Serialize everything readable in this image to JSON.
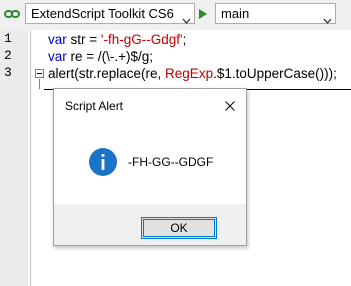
{
  "toolbar": {
    "target_app": "ExtendScript Toolkit CS6",
    "engine": "main",
    "link_icon": "link-icon",
    "run_icon": "run-arrow-icon",
    "dropdown_icon": "chevron-down-icon",
    "accent_color": "#2c8a2c"
  },
  "editor": {
    "line_numbers": [
      "1",
      "2",
      "3"
    ],
    "lines": [
      {
        "tokens": [
          [
            "kw",
            "var"
          ],
          [
            "plain",
            " str = "
          ],
          [
            "str",
            "'-fh-gG--Gdgf'"
          ],
          [
            "plain",
            ";"
          ]
        ]
      },
      {
        "tokens": [
          [
            "kw",
            "var"
          ],
          [
            "plain",
            " re = /(\\-.+)$/g;"
          ]
        ]
      },
      {
        "tokens": [
          [
            "plain",
            "alert(str.replace(re, "
          ],
          [
            "cls",
            "RegExp"
          ],
          [
            "plain",
            ".$1.toUpperCase()));"
          ]
        ]
      }
    ],
    "keyword_color": "#0000c0",
    "string_color": "#c00000"
  },
  "dialog": {
    "title": "Script Alert",
    "message": "-FH-GG--GDGF",
    "ok_label": "OK",
    "icon": "info-icon",
    "icon_color": "#1a73c9"
  }
}
